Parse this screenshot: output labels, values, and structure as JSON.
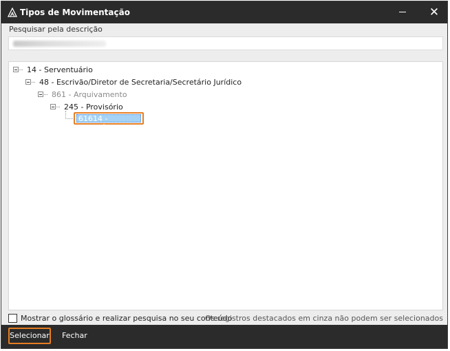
{
  "window": {
    "title": "Tipos de Movimentação",
    "minimize_glyph": "",
    "close_glyph": "✕"
  },
  "search": {
    "label": "Pesquisar pela descrição",
    "value": ""
  },
  "tree": {
    "nodes": [
      {
        "label": "14 - Serventuário",
        "level": 0,
        "state": "expanded",
        "enabled": true
      },
      {
        "label": "48 - Escrivão/Diretor de Secretaria/Secretário Jurídico",
        "level": 1,
        "state": "expanded",
        "enabled": true
      },
      {
        "label": "861 - Arquivamento",
        "level": 2,
        "state": "expanded",
        "enabled": false
      },
      {
        "label": "245 - Provisório",
        "level": 3,
        "state": "expanded",
        "enabled": true
      },
      {
        "label": "61614 - Provisório",
        "level": 4,
        "state": "leaf",
        "enabled": true,
        "selected": true
      }
    ]
  },
  "options": {
    "glossary_checkbox_label": "Mostrar o glossário e realizar pesquisa no seu conteúdo",
    "glossary_checked": false,
    "note": "Os registros destacados em cinza não podem ser selecionados"
  },
  "footer": {
    "select_label": "Selecionar",
    "close_label": "Fechar"
  },
  "colors": {
    "titlebar": "#2b2b2b",
    "accent_outline": "#e67e22",
    "selection_fill": "#a6d3f5",
    "disabled_text": "#8a8a8a"
  }
}
